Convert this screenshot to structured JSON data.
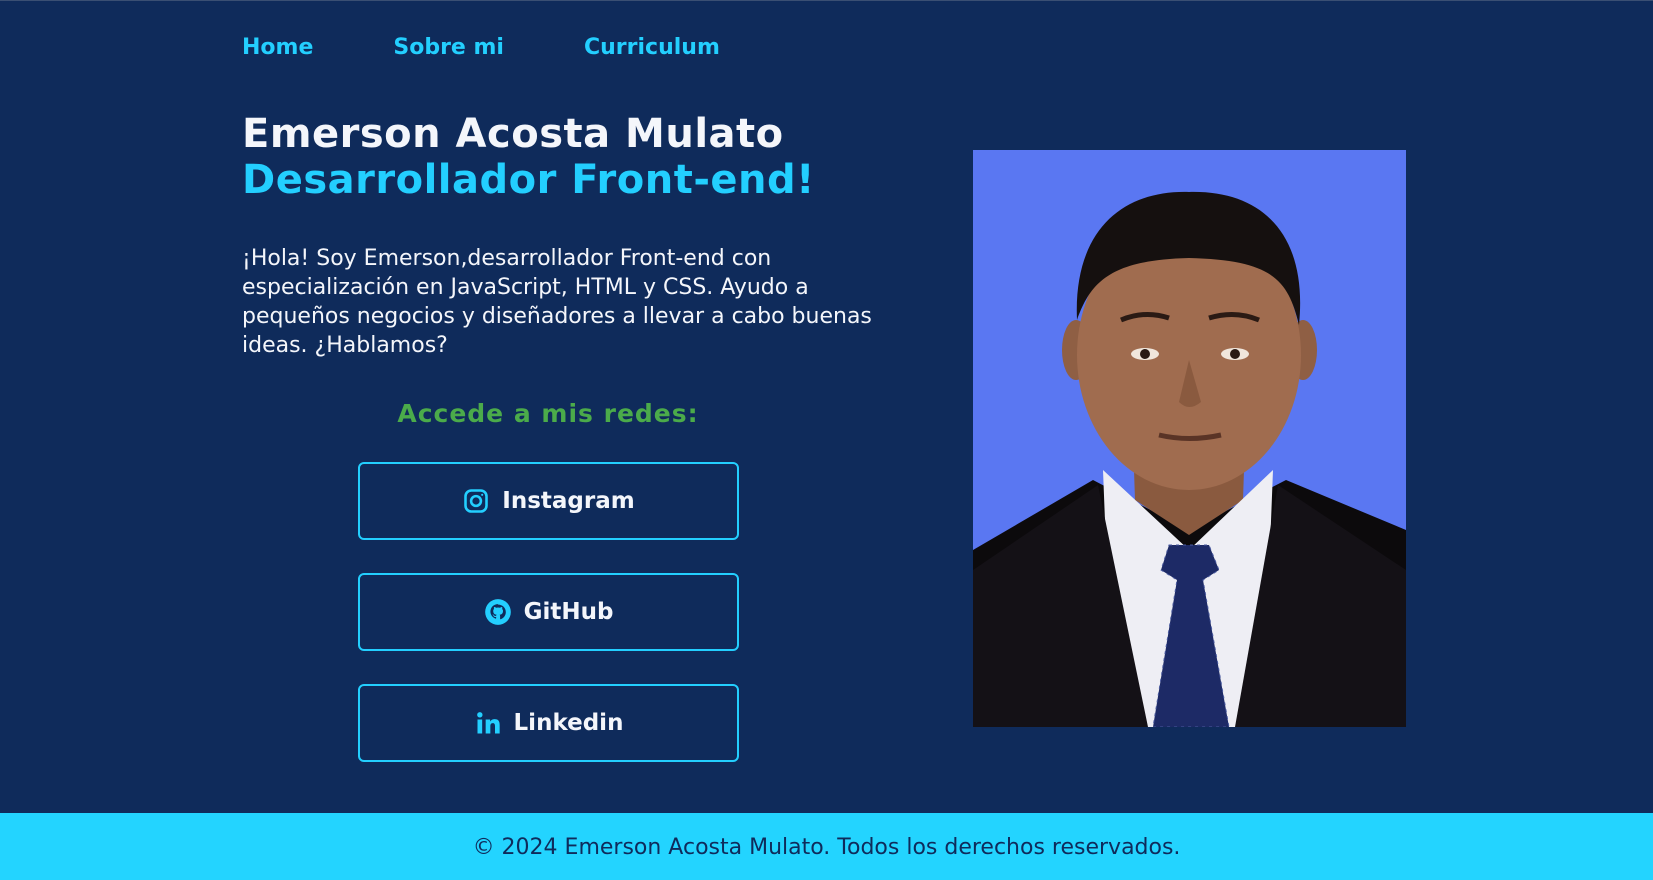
{
  "nav": {
    "items": [
      {
        "label": "Home"
      },
      {
        "label": "Sobre mi"
      },
      {
        "label": "Curriculum"
      }
    ]
  },
  "hero": {
    "name": "Emerson Acosta Mulato",
    "role": "Desarrollador Front-end!",
    "intro": "¡Hola! Soy Emerson,desarrollador Front-end con especialización en JavaScript, HTML y CSS. Ayudo a pequeños negocios y diseñadores a llevar a cabo buenas ideas. ¿Hablamos?"
  },
  "social": {
    "heading": "Accede a mis redes:",
    "links": [
      {
        "label": "Instagram",
        "icon": "instagram-icon"
      },
      {
        "label": "GitHub",
        "icon": "github-icon"
      },
      {
        "label": "Linkedin",
        "icon": "linkedin-icon"
      }
    ]
  },
  "footer": {
    "copyright": "© 2024 Emerson Acosta Mulato. Todos los derechos reservados."
  },
  "colors": {
    "background": "#0f2b5b",
    "accent": "#23cfff",
    "social_heading": "#4bab4a",
    "text": "#f4f6fb",
    "footer_bg": "#23d4ff",
    "photo_bg": "#5a77f2"
  }
}
